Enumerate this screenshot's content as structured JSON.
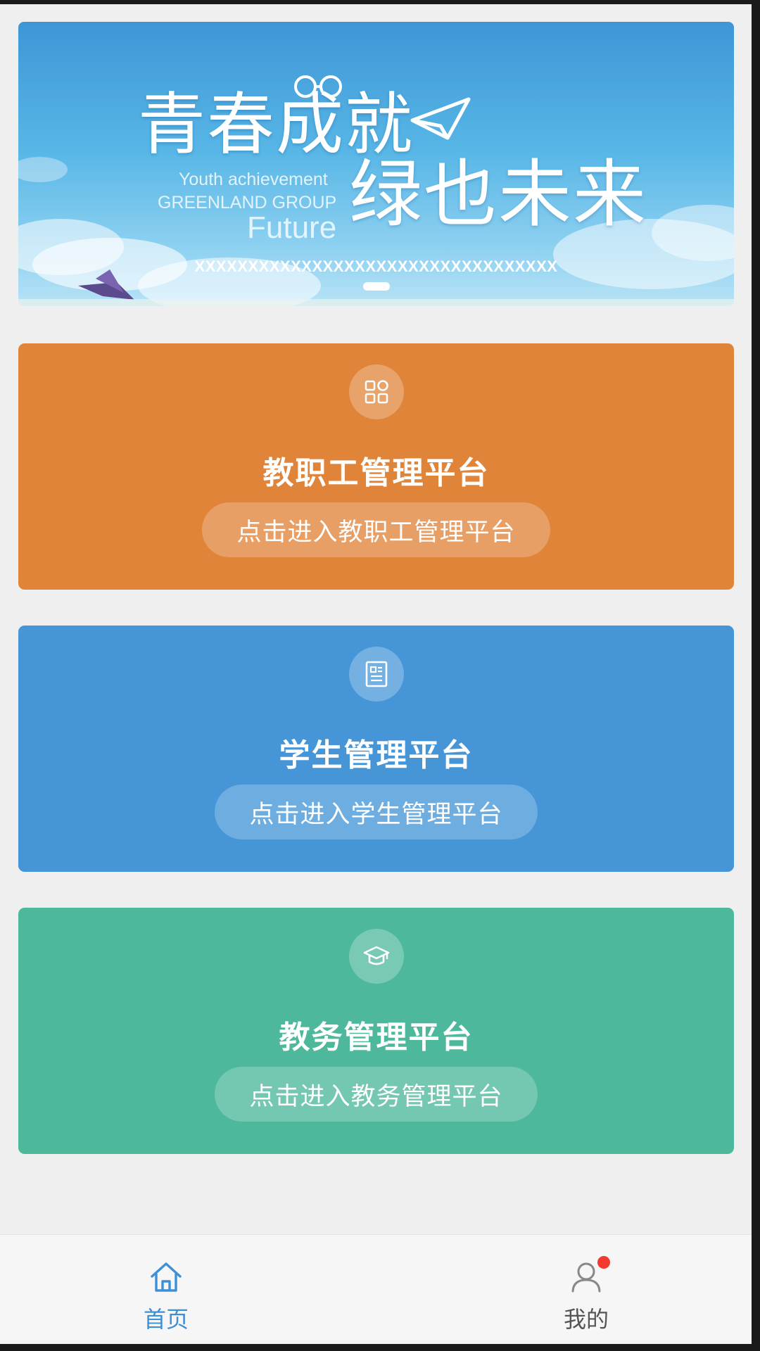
{
  "banner": {
    "title_line1": "青春成就",
    "title_line2": "绿也未来",
    "english_line1": "Youth achievement",
    "english_line2": "GREENLAND GROUP",
    "english_line3": "Future",
    "caption": "XXXXXXXXXXXXXXXXXXXXXXXXXXXXXXXXXX",
    "slide_count": 1,
    "active_slide": 1
  },
  "cards": [
    {
      "icon": "grid-apps-icon",
      "title": "教职工管理平台",
      "button_label": "点击进入教职工管理平台",
      "color": "#e0843a"
    },
    {
      "icon": "document-list-icon",
      "title": "学生管理平台",
      "button_label": "点击进入学生管理平台",
      "color": "#4696d7"
    },
    {
      "icon": "graduation-cap-icon",
      "title": "教务管理平台",
      "button_label": "点击进入教务管理平台",
      "color": "#4db89b"
    }
  ],
  "tabbar": {
    "tabs": [
      {
        "label": "首页",
        "icon": "home-icon",
        "active": true
      },
      {
        "label": "我的",
        "icon": "user-icon",
        "active": false,
        "badge": true
      }
    ],
    "active_color": "#3d8fd6",
    "inactive_color": "#555555",
    "badge_color": "#f23a2e"
  }
}
